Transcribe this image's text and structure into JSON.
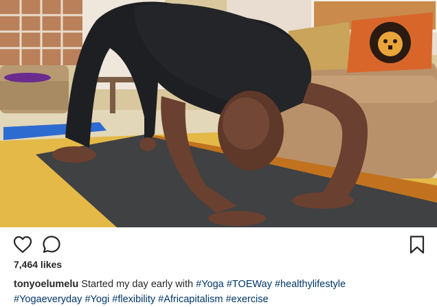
{
  "post": {
    "likes_text": "7,464 likes",
    "username": "tonyoelumelu",
    "caption_text": "Started my day early with",
    "hashtags": [
      "#Yoga",
      "#TOEWay",
      "#healthylifestyle",
      "#Yogaeveryday",
      "#Yogi",
      "#flexibility",
      "#Africapitalism",
      "#exercise"
    ]
  },
  "actions": {
    "like_icon": "heart-outline-icon",
    "comment_icon": "speech-bubble-icon",
    "save_icon": "bookmark-icon"
  },
  "colors": {
    "text": "#262626",
    "hashtag": "#003569",
    "background": "#ffffff"
  }
}
